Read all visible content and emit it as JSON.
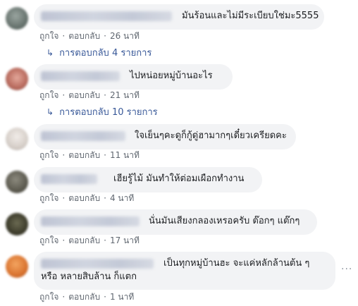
{
  "comments": [
    {
      "text": "มันร้อนและไม่มีระเบียบใช่มะ5555",
      "like": "ถูกใจ",
      "reply": "ตอบกลับ",
      "time": "26 นาที",
      "replies_link": "การตอบกลับ 4 รายการ"
    },
    {
      "text": "ไปหน่อยหมู่บ้านอะไร",
      "like": "ถูกใจ",
      "reply": "ตอบกลับ",
      "time": "21 นาที",
      "replies_link": "การตอบกลับ 10 รายการ"
    },
    {
      "text": "ใจเย็นๆคะดูก็กู้ดู่ฮามากๆเดี๋ยวเครียดคะ",
      "like": "ถูกใจ",
      "reply": "ตอบกลับ",
      "time": "11 นาที"
    },
    {
      "text": "เฮียรู้ไม้ มันทำให้ต่อมเผือกทำงาน",
      "like": "ถูกใจ",
      "reply": "ตอบกลับ",
      "time": "4 นาที"
    },
    {
      "text": "นั่นมันเสียงกลองเหรอครับ ต๊อกๆ แต๊กๆ",
      "like": "ถูกใจ",
      "reply": "ตอบกลับ",
      "time": "17 นาที"
    },
    {
      "text_line1": "เป็นทุกหมู่บ้านฮะ จะแค่หลักล้านต้น ๆ",
      "text_line2": "หรือ หลายสิบล้าน ก็แตก",
      "like": "ถูกใจ",
      "reply": "ตอบกลับ",
      "time": "1 นาที"
    }
  ],
  "icons": {
    "reply_arrow": "reply-arrow-icon",
    "more_options": "more-options-icon"
  },
  "colors": {
    "bubble_bg": "#f2f3f5",
    "meta_text": "#606770",
    "link_blue": "#385898"
  }
}
